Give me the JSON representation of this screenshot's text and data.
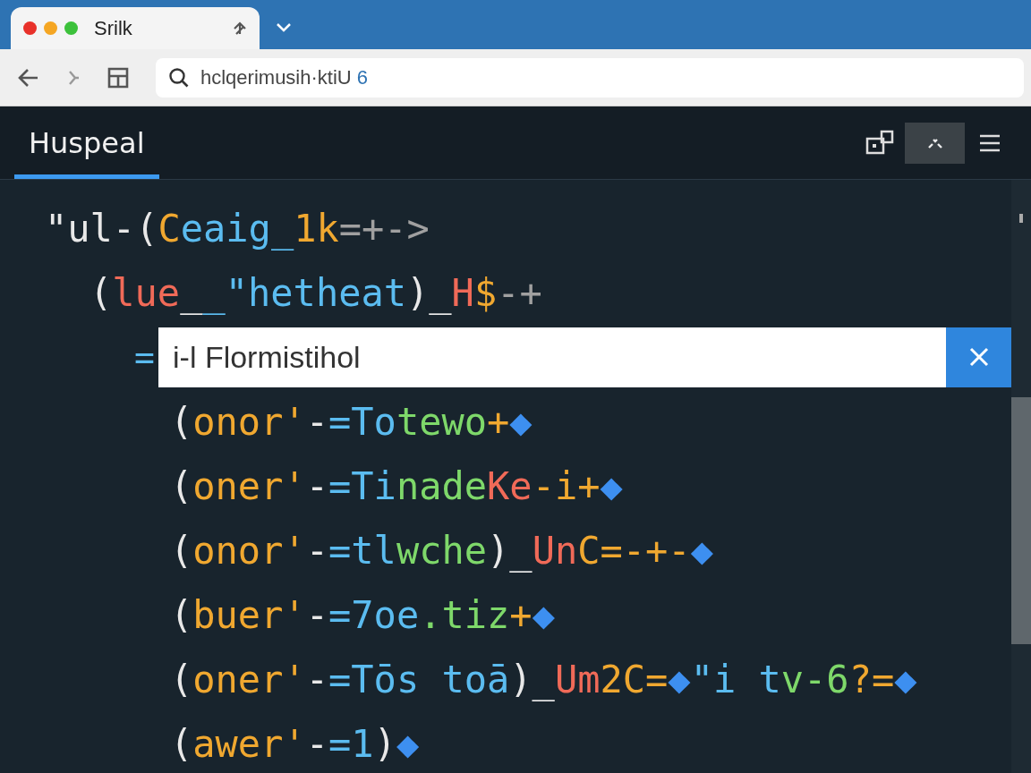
{
  "browser": {
    "tab": {
      "title": "Srilk"
    },
    "address": {
      "value": "hclqerimusih·ktiU",
      "badge": "6"
    }
  },
  "app": {
    "tabs": [
      {
        "label": "Huspeal",
        "selected": true
      }
    ],
    "toolbar": [
      {
        "kind": "widget",
        "selected": false
      },
      {
        "kind": "faces",
        "selected": true
      },
      {
        "kind": "menu",
        "selected": false
      }
    ]
  },
  "code": {
    "lines": [
      {
        "kind": "code",
        "tokens": [
          {
            "text": "\"ul-(",
            "color": "#e8e8e8"
          },
          {
            "text": "C",
            "color": "#f0a830"
          },
          {
            "text": "eaig_",
            "color": "#5bbcf0"
          },
          {
            "text": "1k",
            "color": "#f0a830"
          },
          {
            "text": "=+->",
            "color": "#a0a0a0"
          }
        ],
        "children": [
          {
            "kind": "code",
            "tokens": [
              {
                "text": "(",
                "color": "#e8e8e8"
              },
              {
                "text": "lue",
                "color": "#f06a58"
              },
              {
                "text": "_",
                "color": "#e8e8e8"
              },
              {
                "text": "_\"hetheat",
                "color": "#5bbcf0"
              },
              {
                "text": ")_",
                "color": "#e8e8e8"
              },
              {
                "text": "H",
                "color": "#f06a58"
              },
              {
                "text": "$",
                "color": "#f0a830"
              },
              {
                "text": "-+",
                "color": "#a0a0a0"
              }
            ],
            "children": [
              {
                "kind": "find",
                "prefix": "=",
                "value": "i-l Flormistihol",
                "children": [
                  {
                    "kind": "code",
                    "tokens": [
                      {
                        "text": "(",
                        "color": "#e8e8e8"
                      },
                      {
                        "text": "onor'",
                        "color": "#f0a830"
                      },
                      {
                        "text": "-",
                        "color": "#e8e8e8"
                      },
                      {
                        "text": "=To",
                        "color": "#5bbcf0"
                      },
                      {
                        "text": "tewo",
                        "color": "#7ed86a"
                      },
                      {
                        "text": "+",
                        "color": "#f0a830"
                      },
                      {
                        "text": "◆",
                        "color": "#3d8ff0"
                      }
                    ]
                  },
                  {
                    "kind": "code",
                    "tokens": [
                      {
                        "text": "(",
                        "color": "#e8e8e8"
                      },
                      {
                        "text": "oner'",
                        "color": "#f0a830"
                      },
                      {
                        "text": "-",
                        "color": "#e8e8e8"
                      },
                      {
                        "text": "=Ti",
                        "color": "#5bbcf0"
                      },
                      {
                        "text": "nade",
                        "color": "#7ed86a"
                      },
                      {
                        "text": "Ke",
                        "color": "#f06a58"
                      },
                      {
                        "text": "-i+",
                        "color": "#f0a830"
                      },
                      {
                        "text": "◆",
                        "color": "#3d8ff0"
                      }
                    ]
                  },
                  {
                    "kind": "code",
                    "tokens": [
                      {
                        "text": "(",
                        "color": "#e8e8e8"
                      },
                      {
                        "text": "onor'",
                        "color": "#f0a830"
                      },
                      {
                        "text": "-",
                        "color": "#e8e8e8"
                      },
                      {
                        "text": "=tl",
                        "color": "#5bbcf0"
                      },
                      {
                        "text": "wche",
                        "color": "#7ed86a"
                      },
                      {
                        "text": ")_",
                        "color": "#e8e8e8"
                      },
                      {
                        "text": "Un",
                        "color": "#f06a58"
                      },
                      {
                        "text": "C=-+-",
                        "color": "#f0a830"
                      },
                      {
                        "text": "◆",
                        "color": "#3d8ff0"
                      }
                    ]
                  },
                  {
                    "kind": "code",
                    "tokens": [
                      {
                        "text": "(",
                        "color": "#e8e8e8"
                      },
                      {
                        "text": "buer'",
                        "color": "#f0a830"
                      },
                      {
                        "text": "-",
                        "color": "#e8e8e8"
                      },
                      {
                        "text": "=7oe",
                        "color": "#5bbcf0"
                      },
                      {
                        "text": ".tiz",
                        "color": "#7ed86a"
                      },
                      {
                        "text": "+",
                        "color": "#f0a830"
                      },
                      {
                        "text": "◆",
                        "color": "#3d8ff0"
                      }
                    ]
                  },
                  {
                    "kind": "code",
                    "tokens": [
                      {
                        "text": "(",
                        "color": "#e8e8e8"
                      },
                      {
                        "text": "oner'",
                        "color": "#f0a830"
                      },
                      {
                        "text": "-",
                        "color": "#e8e8e8"
                      },
                      {
                        "text": "=Tōs toā",
                        "color": "#5bbcf0"
                      },
                      {
                        "text": ")_",
                        "color": "#e8e8e8"
                      },
                      {
                        "text": "Um",
                        "color": "#f06a58"
                      },
                      {
                        "text": "2C=",
                        "color": "#f0a830"
                      },
                      {
                        "text": "◆",
                        "color": "#3d8ff0"
                      },
                      {
                        "text": "\"i t",
                        "color": "#5bbcf0"
                      },
                      {
                        "text": "v-6",
                        "color": "#7ed86a"
                      },
                      {
                        "text": "?=",
                        "color": "#f0a830"
                      },
                      {
                        "text": "◆",
                        "color": "#3d8ff0"
                      }
                    ]
                  },
                  {
                    "kind": "code",
                    "tokens": [
                      {
                        "text": "(",
                        "color": "#e8e8e8"
                      },
                      {
                        "text": "awer'",
                        "color": "#f0a830"
                      },
                      {
                        "text": "-",
                        "color": "#e8e8e8"
                      },
                      {
                        "text": "=1",
                        "color": "#5bbcf0"
                      },
                      {
                        "text": ")",
                        "color": "#e8e8e8"
                      },
                      {
                        "text": "◆",
                        "color": "#3d8ff0"
                      }
                    ]
                  }
                ]
              }
            ]
          }
        ]
      }
    ]
  }
}
